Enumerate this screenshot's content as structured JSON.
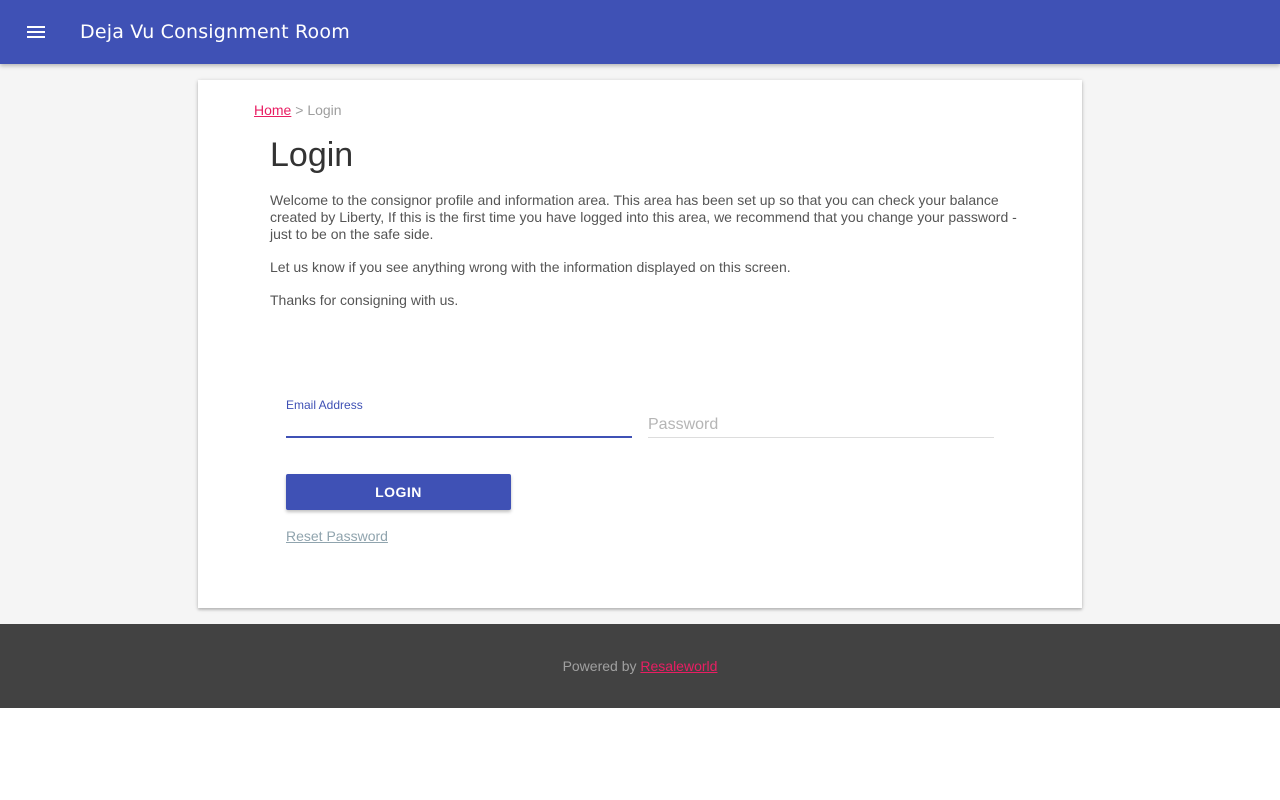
{
  "header": {
    "title": "Deja Vu Consignment Room",
    "menu_icon": "menu-icon",
    "background_color": "#3f51b5"
  },
  "breadcrumb": {
    "home_label": "Home",
    "separator": ">",
    "current": "Login"
  },
  "main": {
    "title": "Login",
    "paragraphs": [
      "Welcome to the consignor profile and information area. This area has been set up so that you can check your balance created by Liberty, If this is the first time you have logged into this area, we recommend that you change your password - just to be on the safe side.",
      "Let us know if you see anything wrong with the information displayed on this screen.",
      "Thanks for consigning with us."
    ]
  },
  "form": {
    "email_label": "Email Address",
    "email_value": "",
    "password_placeholder": "Password",
    "password_value": "",
    "login_label": "LOGIN",
    "reset_label": "Reset Password"
  },
  "footer": {
    "powered_by": "Powered by",
    "link_label": "Resaleworld"
  },
  "colors": {
    "primary": "#3f51b5",
    "accent": "#e91e63",
    "footer_bg": "#424242"
  }
}
